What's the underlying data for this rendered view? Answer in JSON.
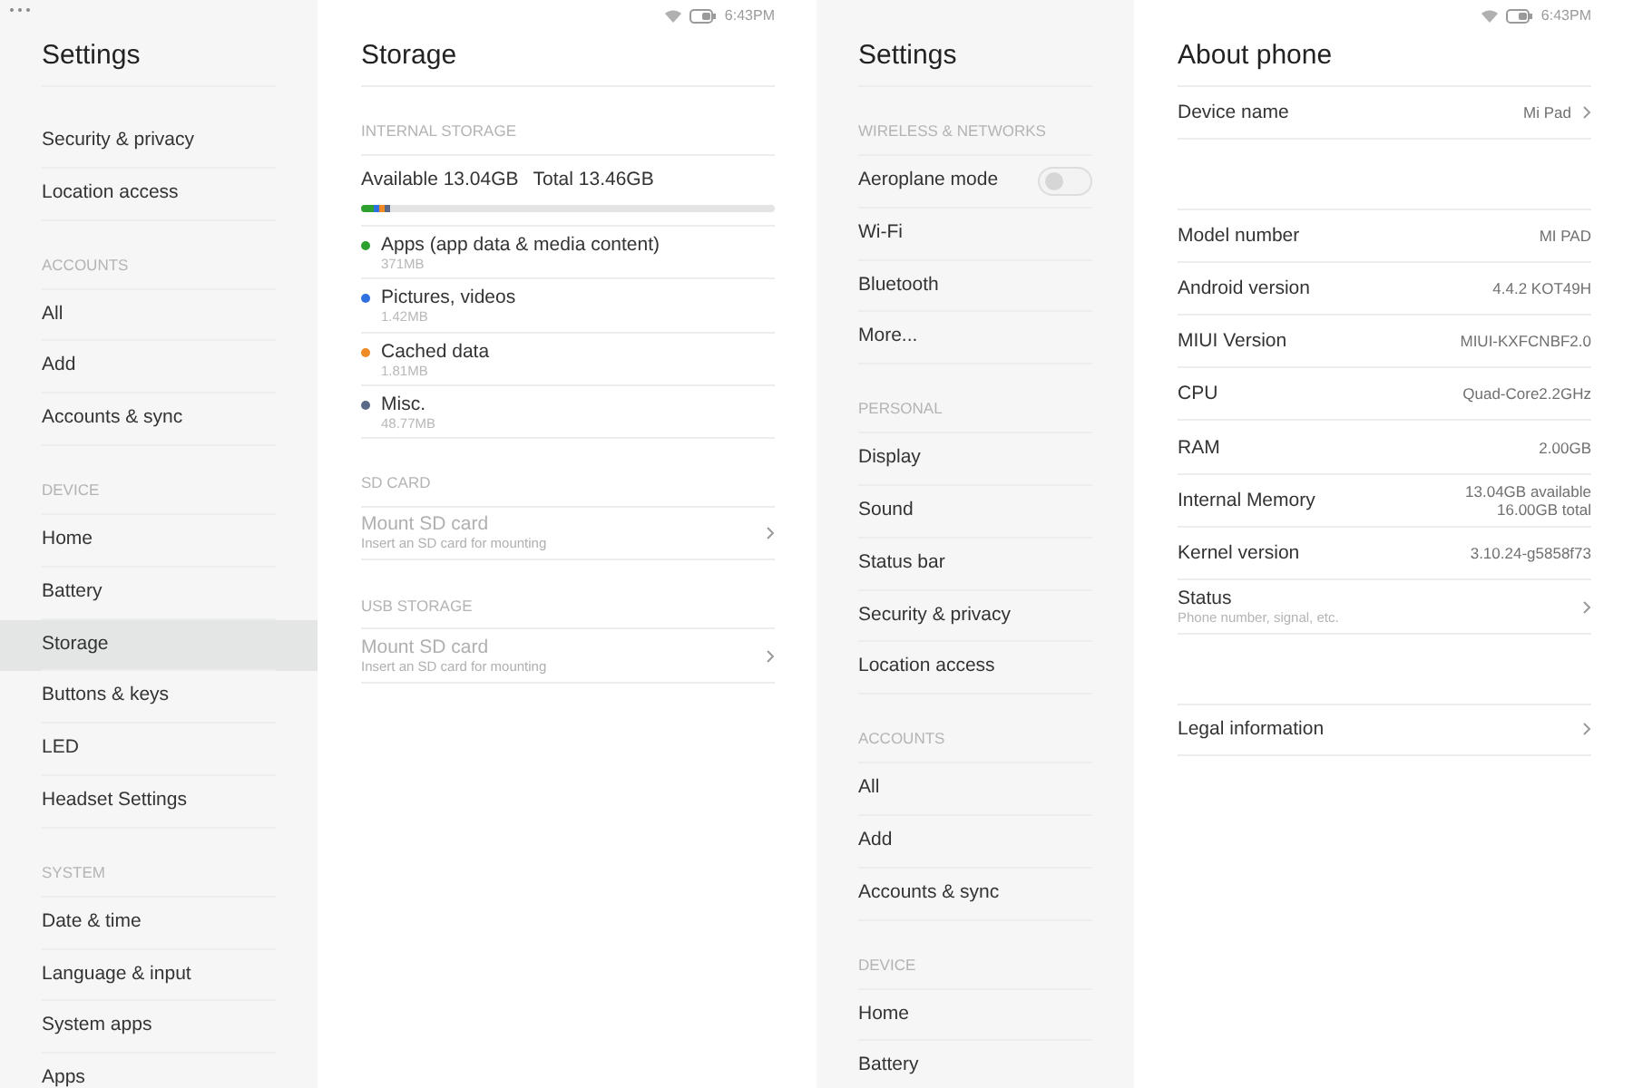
{
  "screens": [
    {
      "status_bar": {
        "time": "6:43PM",
        "overflow_menu": true
      },
      "sidebar": {
        "title": "Settings",
        "sections": [
          {
            "items": [
              {
                "label": "Security & privacy",
                "kind": "link",
                "selected": false
              },
              {
                "label": "Location access",
                "kind": "link",
                "selected": false
              }
            ]
          },
          {
            "header": "ACCOUNTS",
            "items": [
              {
                "label": "All",
                "kind": "link",
                "selected": false
              },
              {
                "label": "Add",
                "kind": "link",
                "selected": false
              },
              {
                "label": "Accounts & sync",
                "kind": "link",
                "selected": false
              }
            ]
          },
          {
            "header": "DEVICE",
            "items": [
              {
                "label": "Home",
                "kind": "link",
                "selected": false
              },
              {
                "label": "Battery",
                "kind": "link",
                "selected": false
              },
              {
                "label": "Storage",
                "kind": "link",
                "selected": true
              },
              {
                "label": "Buttons & keys",
                "kind": "link",
                "selected": false
              },
              {
                "label": "LED",
                "kind": "link",
                "selected": false
              },
              {
                "label": "Headset Settings",
                "kind": "link",
                "selected": false
              }
            ]
          },
          {
            "header": "SYSTEM",
            "items": [
              {
                "label": "Date & time",
                "kind": "link",
                "selected": false
              },
              {
                "label": "Language & input",
                "kind": "link",
                "selected": false
              },
              {
                "label": "System apps",
                "kind": "link",
                "selected": false
              },
              {
                "label": "Apps",
                "kind": "link",
                "selected": false
              }
            ]
          }
        ]
      },
      "content": {
        "kind": "storage",
        "title": "Storage",
        "internal": {
          "header": "INTERNAL STORAGE",
          "available": "Available 13.04GB",
          "total": "Total 13.46GB",
          "segments": [
            {
              "color": "#2ea02e",
              "level": 0.032
            },
            {
              "color": "#2f6fe0",
              "level": 0.013
            },
            {
              "color": "#f08a24",
              "level": 0.013
            },
            {
              "color": "#5a6a86",
              "level": 0.013
            }
          ],
          "categories": [
            {
              "name": "Apps (app data & media content)",
              "size": "371MB",
              "color": "#2ea02e"
            },
            {
              "name": "Pictures, videos",
              "size": "1.42MB",
              "color": "#2f6fe0"
            },
            {
              "name": "Cached data",
              "size": "1.81MB",
              "color": "#f08a24"
            },
            {
              "name": "Misc.",
              "size": "48.77MB",
              "color": "#5a6a86"
            }
          ]
        },
        "sections": [
          {
            "header": "SD CARD",
            "title": "Mount SD card",
            "subtitle": "Insert an SD card for mounting",
            "disabled": true
          },
          {
            "header": "USB STORAGE",
            "title": "Mount SD card",
            "subtitle": "Insert an SD card for mounting",
            "disabled": true
          }
        ]
      }
    },
    {
      "status_bar": {
        "time": "6:43PM",
        "overflow_menu": false
      },
      "sidebar": {
        "title": "Settings",
        "sections": [
          {
            "header": "WIRELESS & NETWORKS",
            "items": [
              {
                "label": "Aeroplane mode",
                "kind": "toggle",
                "on": false,
                "selected": false
              },
              {
                "label": "Wi-Fi",
                "kind": "link",
                "selected": false
              },
              {
                "label": "Bluetooth",
                "kind": "link",
                "selected": false
              },
              {
                "label": "More...",
                "kind": "link",
                "selected": false
              }
            ]
          },
          {
            "header": "PERSONAL",
            "items": [
              {
                "label": "Display",
                "kind": "link",
                "selected": false
              },
              {
                "label": "Sound",
                "kind": "link",
                "selected": false
              },
              {
                "label": "Status bar",
                "kind": "link",
                "selected": false
              },
              {
                "label": "Security & privacy",
                "kind": "link",
                "selected": false
              },
              {
                "label": "Location access",
                "kind": "link",
                "selected": false
              }
            ]
          },
          {
            "header": "ACCOUNTS",
            "items": [
              {
                "label": "All",
                "kind": "link",
                "selected": false
              },
              {
                "label": "Add",
                "kind": "link",
                "selected": false
              },
              {
                "label": "Accounts & sync",
                "kind": "link",
                "selected": false
              }
            ]
          },
          {
            "header": "DEVICE",
            "items": [
              {
                "label": "Home",
                "kind": "link",
                "selected": false
              },
              {
                "label": "Battery",
                "kind": "link",
                "selected": false
              }
            ]
          }
        ]
      },
      "content": {
        "kind": "about",
        "title": "About phone",
        "groups": [
          [
            {
              "label": "Device name",
              "value": "Mi Pad",
              "chevron": true
            }
          ],
          [
            {
              "label": "Model number",
              "value": "MI PAD",
              "chevron": false
            },
            {
              "label": "Android version",
              "value": "4.4.2 KOT49H",
              "chevron": false
            },
            {
              "label": "MIUI Version",
              "value": "MIUI-KXFCNBF2.0",
              "chevron": false
            },
            {
              "label": "CPU",
              "value": "Quad-Core2.2GHz",
              "chevron": false
            },
            {
              "label": "RAM",
              "value": "2.00GB",
              "chevron": false
            },
            {
              "label": "Internal Memory",
              "value_lines": [
                "13.04GB available",
                "16.00GB total"
              ],
              "chevron": false
            },
            {
              "label": "Kernel version",
              "value": "3.10.24-g5858f73",
              "chevron": false
            },
            {
              "label": "Status",
              "subtitle": "Phone number, signal, etc.",
              "chevron": true
            }
          ],
          [
            {
              "label": "Legal information",
              "chevron": true
            }
          ]
        ]
      }
    }
  ]
}
